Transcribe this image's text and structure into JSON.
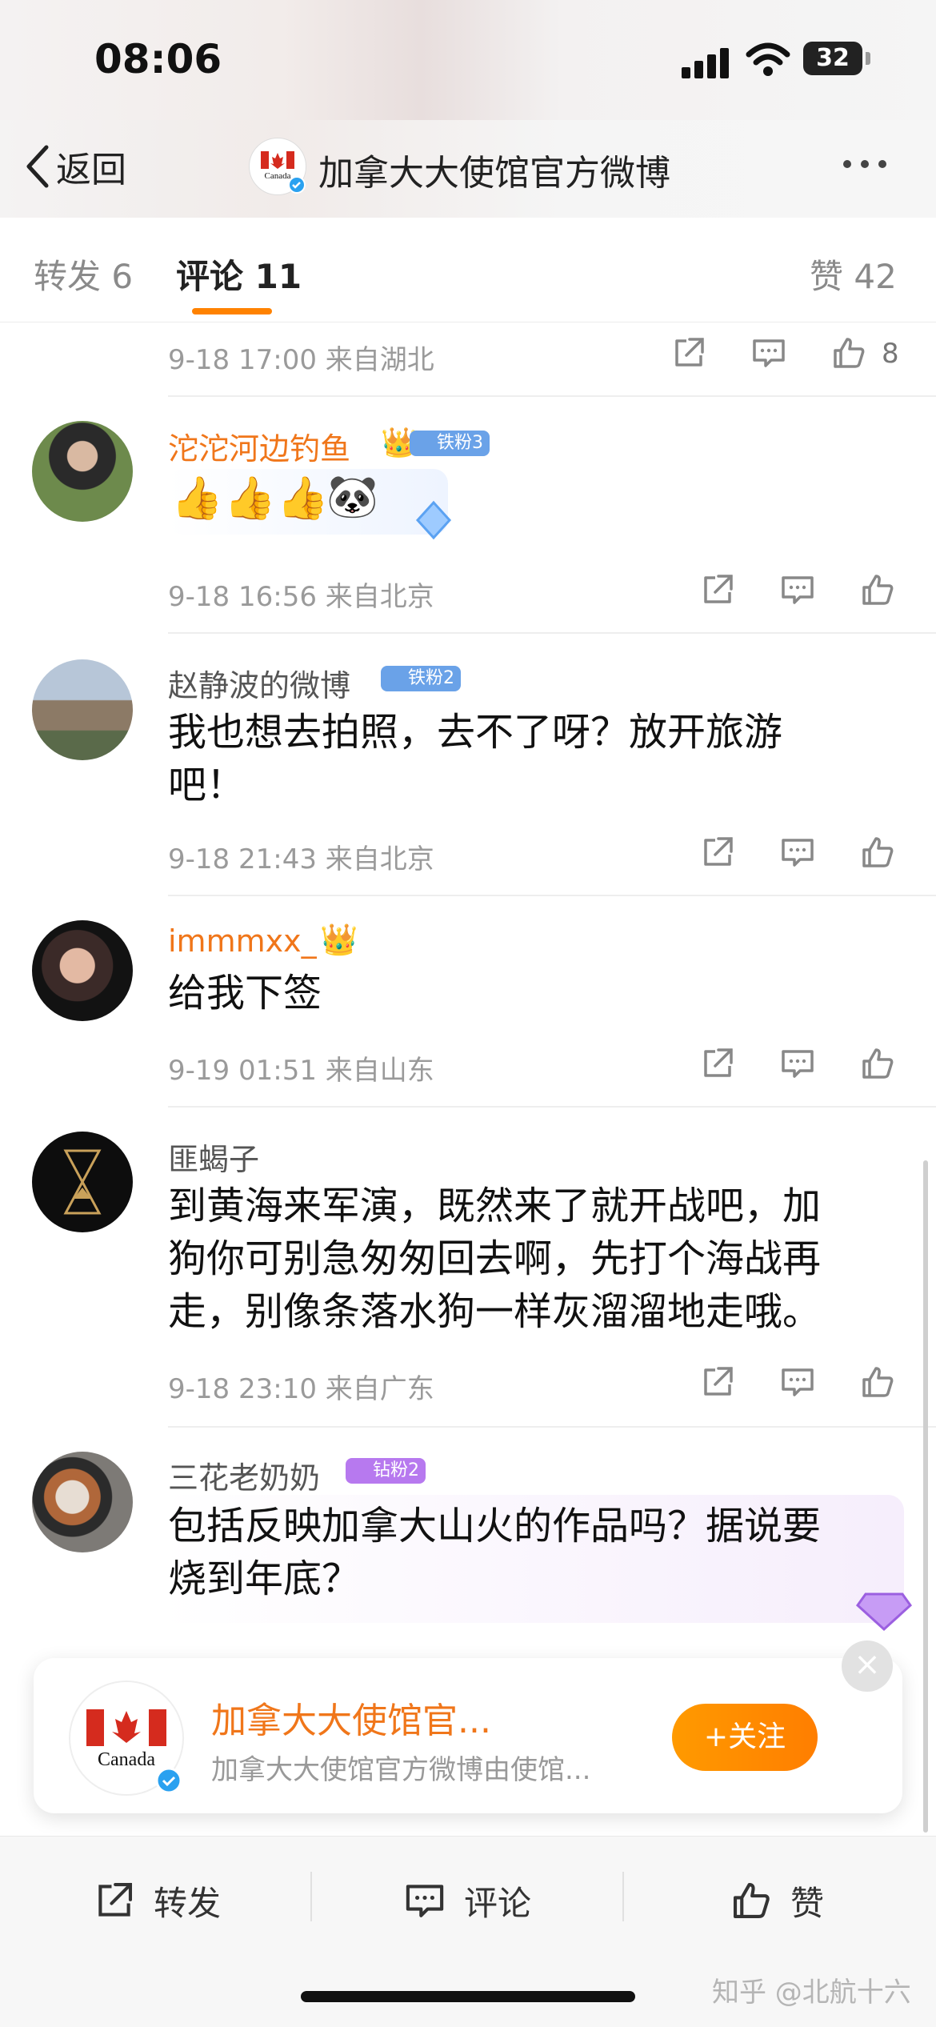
{
  "status": {
    "time": "08:06",
    "battery": "32"
  },
  "nav": {
    "back_label": "返回",
    "title": "加拿大大使馆官方微博"
  },
  "tabs": [
    {
      "label": "转发 6"
    },
    {
      "label": "评论 11"
    },
    {
      "label": "赞 42"
    }
  ],
  "comments": [
    {
      "meta": "9-18 17:00  来自湖北",
      "likes": "8"
    },
    {
      "name": "沱沱河边钓鱼",
      "badge": "铁粉3",
      "text": "",
      "meta": "9-18 16:56  来自北京",
      "emojis": [
        "👍",
        "👍",
        "👍",
        "🐼"
      ]
    },
    {
      "name": "赵静波的微博",
      "badge": "铁粉2",
      "text_lines": [
        "我也想去拍照，去不了呀？放开旅游",
        "吧！"
      ],
      "meta": "9-18 21:43  来自北京"
    },
    {
      "name": "immmxx_",
      "text_lines": [
        "给我下签"
      ],
      "meta": "9-19 01:51  来自山东"
    },
    {
      "name": "匪蝎子",
      "text_lines": [
        "到黄海来军演，既然来了就开战吧，加",
        "狗你可别急匆匆回去啊，先打个海战再",
        "走，别像条落水狗一样灰溜溜地走哦。"
      ],
      "meta": "9-18 23:10  来自广东"
    },
    {
      "name": "三花老奶奶",
      "badge": "钻粉2",
      "text_lines": [
        "包括反映加拿大山火的作品吗？据说要",
        "烧到年底？"
      ]
    }
  ],
  "card": {
    "logo_text": "Canada",
    "name": "加拿大大使馆官...",
    "desc": "加拿大大使馆官方微博由使馆...",
    "follow_label": "+关注"
  },
  "bottom_bar": {
    "repost": "转发",
    "comment": "评论",
    "like": "赞"
  },
  "watermark": "知乎 @北航十六",
  "colors": {
    "accent": "#ff8200",
    "username_vip": "#f0761a",
    "meta": "#9a9a9a"
  }
}
